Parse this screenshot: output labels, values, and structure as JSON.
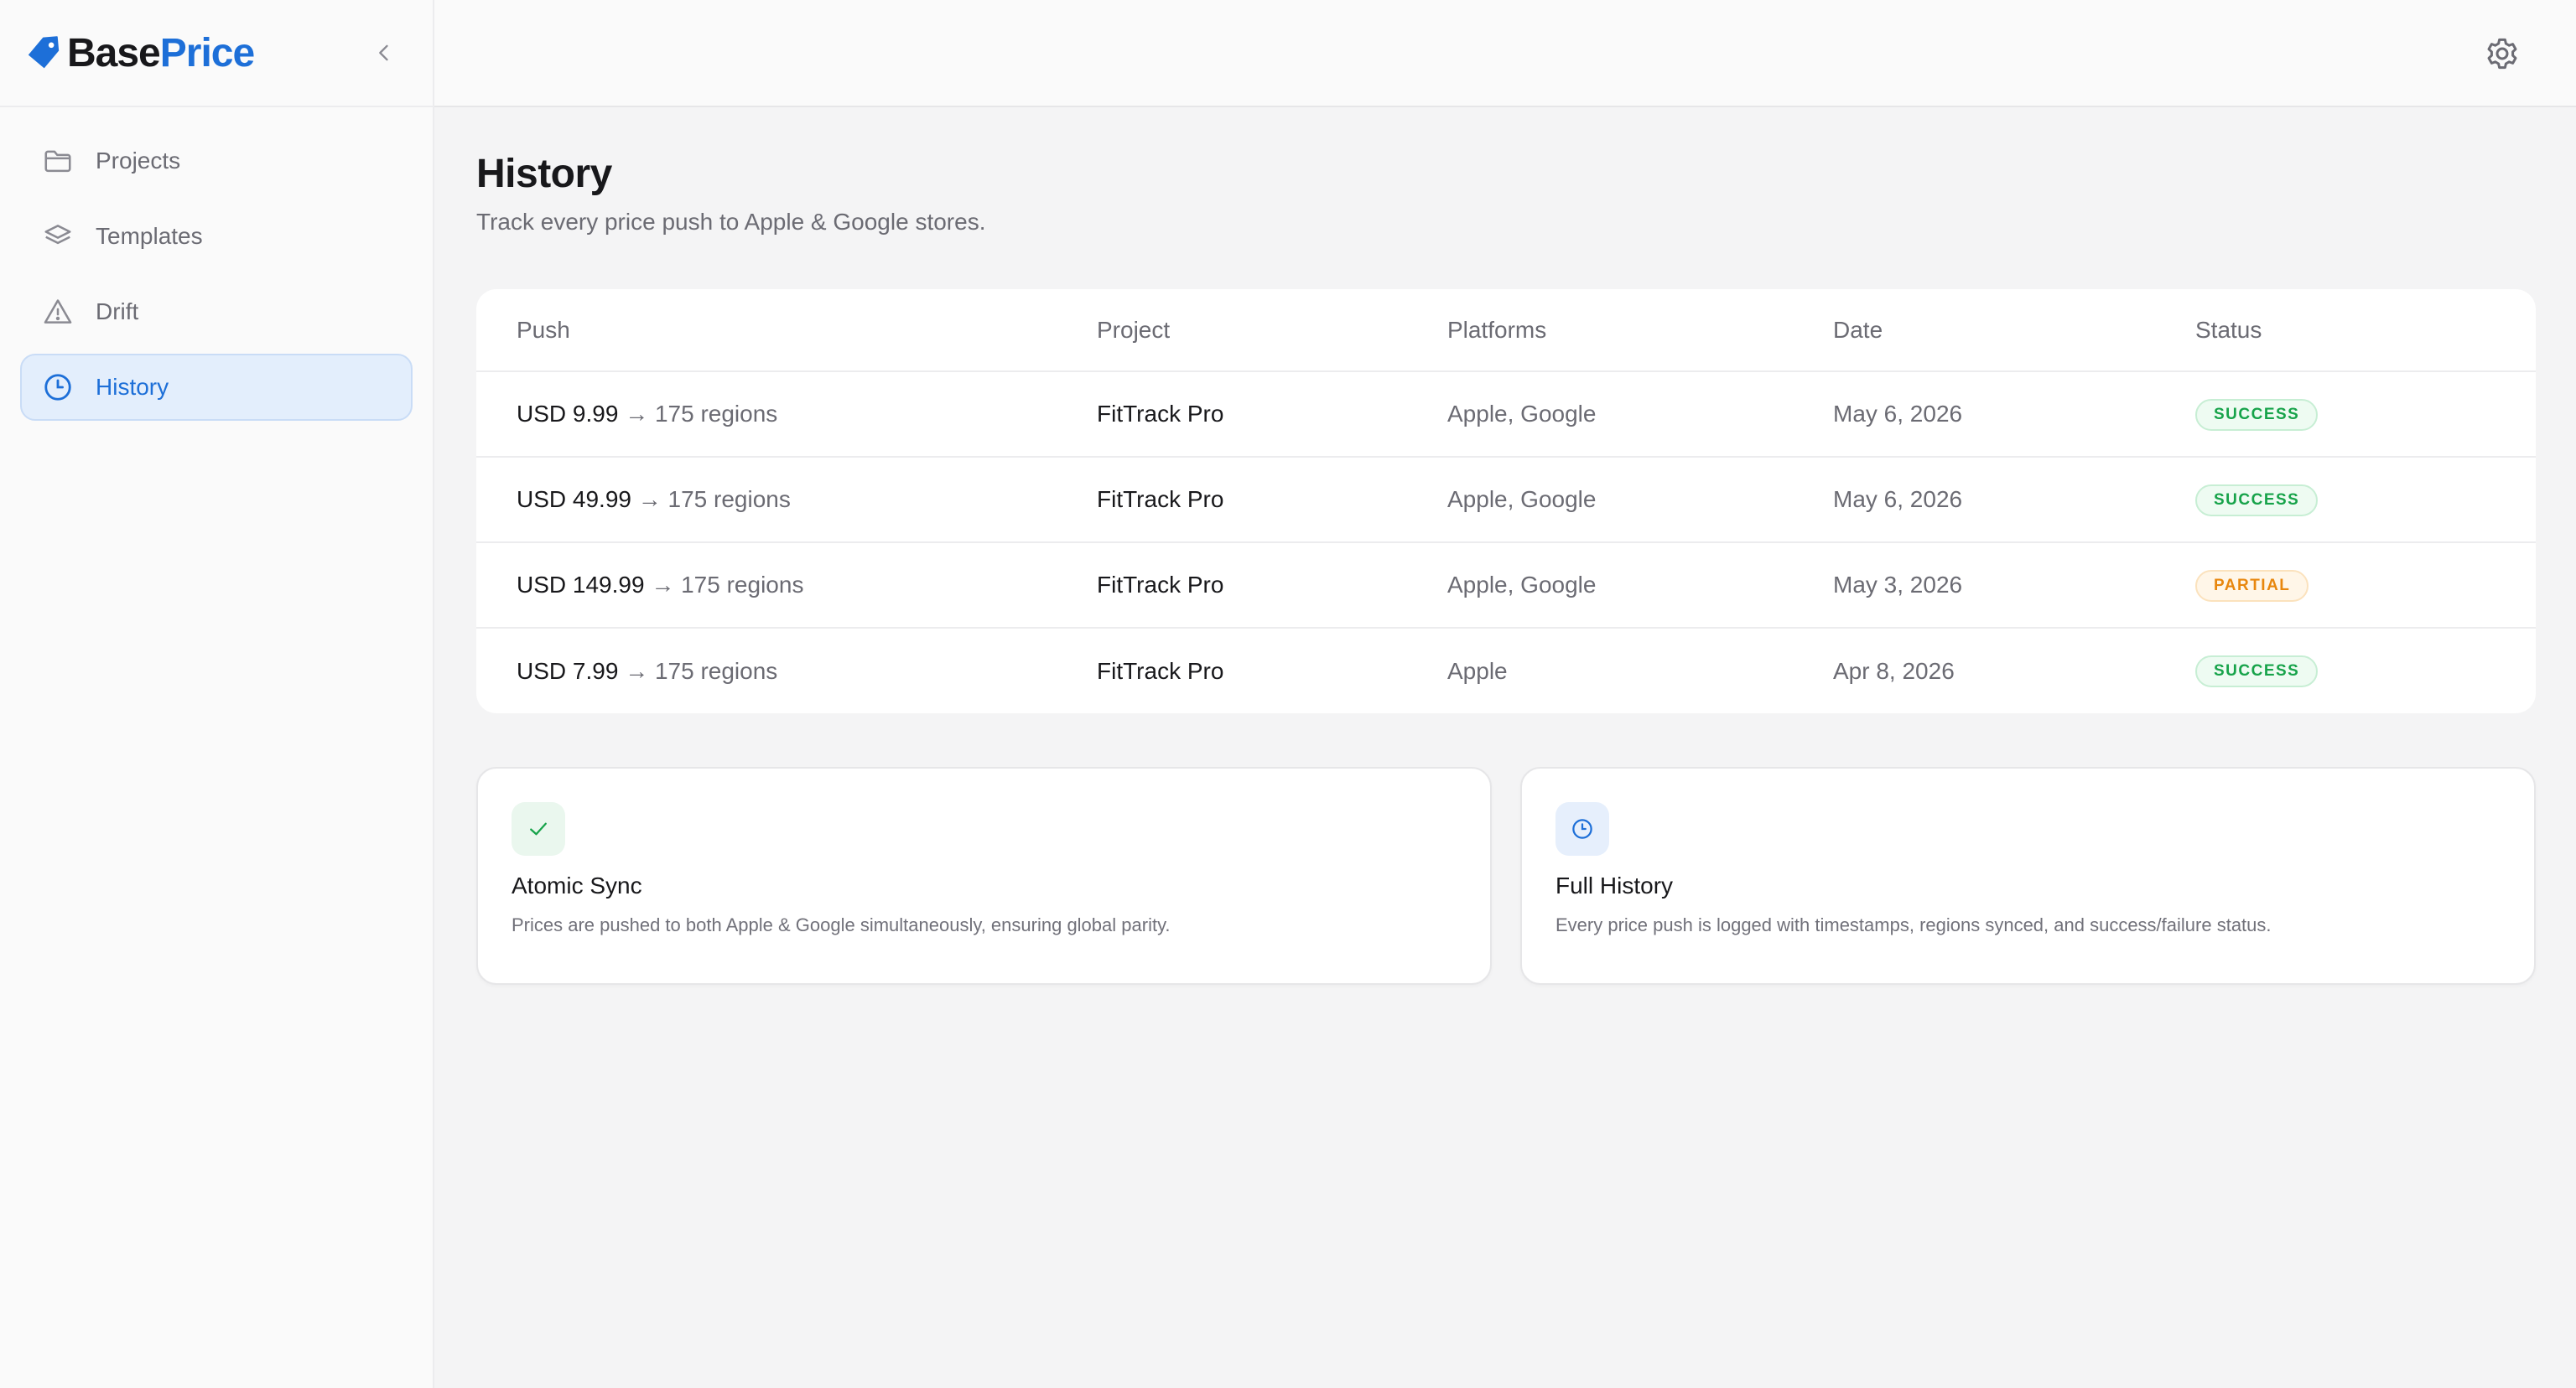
{
  "app": {
    "logo_base": "Base",
    "logo_price": "Price",
    "brand_color": "#1d6fd8"
  },
  "sidebar": {
    "items": [
      {
        "label": "Projects",
        "icon": "folder-icon"
      },
      {
        "label": "Templates",
        "icon": "layers-icon"
      },
      {
        "label": "Drift",
        "icon": "warning-icon"
      },
      {
        "label": "History",
        "icon": "clock-icon",
        "active": true
      }
    ]
  },
  "page": {
    "title": "History",
    "subtitle": "Track every price push to Apple & Google stores."
  },
  "table": {
    "headers": [
      "Push",
      "Project",
      "Platforms",
      "Date",
      "Status"
    ],
    "rows": [
      {
        "amount": "USD 9.99",
        "regions": "→ 175 regions",
        "project": "FitTrack Pro",
        "platforms": "Apple, Google",
        "date": "May 6, 2026",
        "status": "SUCCESS",
        "status_type": "success"
      },
      {
        "amount": "USD 49.99",
        "regions": "→ 175 regions",
        "project": "FitTrack Pro",
        "platforms": "Apple, Google",
        "date": "May 6, 2026",
        "status": "SUCCESS",
        "status_type": "success"
      },
      {
        "amount": "USD 149.99",
        "regions": "→ 175 regions",
        "project": "FitTrack Pro",
        "platforms": "Apple, Google",
        "date": "May 3, 2026",
        "status": "PARTIAL",
        "status_type": "partial"
      },
      {
        "amount": "USD 7.99",
        "regions": "→ 175 regions",
        "project": "FitTrack Pro",
        "platforms": "Apple",
        "date": "Apr 8, 2026",
        "status": "SUCCESS",
        "status_type": "success"
      }
    ]
  },
  "features": [
    {
      "title": "Atomic Sync",
      "desc": "Prices are pushed to both Apple & Google simultaneously, ensuring global parity.",
      "icon": "check-icon"
    },
    {
      "title": "Full History",
      "desc": "Every price push is logged with timestamps, regions synced, and success/failure status.",
      "icon": "clock-icon"
    }
  ]
}
